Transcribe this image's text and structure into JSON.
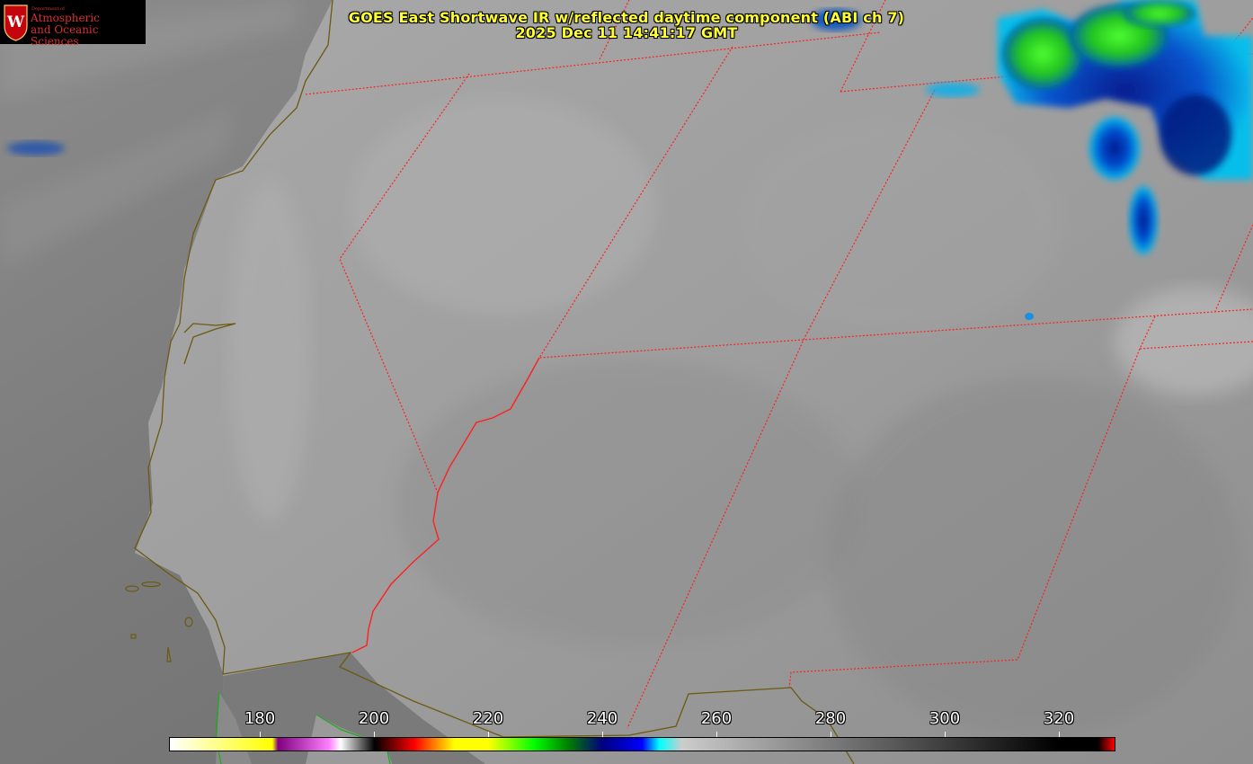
{
  "title": {
    "line1": "GOES East Shortwave IR w/reflected daytime component (ABI ch 7)",
    "line2": "2025 Dec 11 14:41:17 GMT"
  },
  "logo": {
    "department": "Department of",
    "line1": "Atmospheric",
    "line2": "and Oceanic Sciences",
    "seal_letter": "W"
  },
  "colorbar": {
    "min": 164,
    "max": 330,
    "ticks": [
      {
        "value": 180,
        "label": "180"
      },
      {
        "value": 200,
        "label": "200"
      },
      {
        "value": 220,
        "label": "220"
      },
      {
        "value": 240,
        "label": "240"
      },
      {
        "value": 260,
        "label": "260"
      },
      {
        "value": 280,
        "label": "280"
      },
      {
        "value": 300,
        "label": "300"
      },
      {
        "value": 320,
        "label": "320"
      }
    ],
    "stops": [
      {
        "value": 164,
        "color": "#ffffff"
      },
      {
        "value": 182,
        "color": "#ffff00"
      },
      {
        "value": 183,
        "color": "#800080"
      },
      {
        "value": 192,
        "color": "#ff80ff"
      },
      {
        "value": 194,
        "color": "#ffffff"
      },
      {
        "value": 200,
        "color": "#000000"
      },
      {
        "value": 207,
        "color": "#ff0000"
      },
      {
        "value": 214,
        "color": "#ffff00"
      },
      {
        "value": 220,
        "color": "#ffff00"
      },
      {
        "value": 228,
        "color": "#00ff00"
      },
      {
        "value": 234,
        "color": "#008000"
      },
      {
        "value": 240,
        "color": "#000080"
      },
      {
        "value": 247,
        "color": "#0000ff"
      },
      {
        "value": 250,
        "color": "#00ffff"
      },
      {
        "value": 254,
        "color": "#cccccc"
      },
      {
        "value": 320,
        "color": "#000000"
      },
      {
        "value": 327,
        "color": "#000000"
      },
      {
        "value": 330,
        "color": "#ff0000"
      }
    ]
  },
  "colors": {
    "state_border": "#ff2020",
    "coastline": "#6b5a10",
    "title": "#ffff33",
    "logo_text": "#d83030"
  }
}
